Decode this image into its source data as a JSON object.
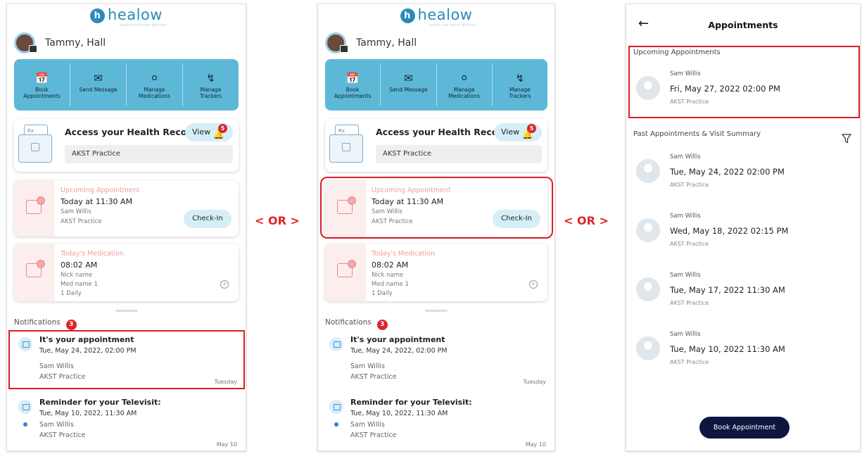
{
  "logo": {
    "text": "healow",
    "tagline": "Health and Online Wellness"
  },
  "separator_text": "< OR >",
  "dashboard": {
    "user_name": "Tammy, Hall",
    "quick_actions": [
      {
        "label": "Book\nAppointments",
        "icon": "calendar-search-icon"
      },
      {
        "label": "Send Message",
        "icon": "envelope-icon"
      },
      {
        "label": "Manage\nMedications",
        "icon": "pill-icon"
      },
      {
        "label": "Manage\nTrackers",
        "icon": "heartbeat-icon"
      }
    ],
    "health_records": {
      "title": "Access your Health Records",
      "view_label": "View",
      "notification_count": "5",
      "practice": "AKST Practice"
    },
    "upcoming": {
      "label": "Upcoming Appointment",
      "time": "Today at 11:30 AM",
      "provider": "Sam Willis",
      "practice": "AKST Practice",
      "checkin_label": "Check-In"
    },
    "medication": {
      "label": "Today's Medication",
      "time": "08:02 AM",
      "nickname": "Nick name",
      "name": "Med name 1",
      "frequency": "1 Daily"
    },
    "notifications_label": "Notifications",
    "notifications_count": "3",
    "notifications": [
      {
        "title": "It's your appointment",
        "date": "Tue, May 24, 2022, 02:00 PM",
        "provider": "Sam Willis",
        "practice": "AKST Practice",
        "day": "Tuesday"
      },
      {
        "title": "Reminder for your Televisit:",
        "date": "Tue, May 10, 2022, 11:30 AM",
        "provider": "Sam Willis",
        "practice": "AKST Practice",
        "day": "May 10"
      }
    ]
  },
  "appointments_screen": {
    "title": "Appointments",
    "upcoming_heading": "Upcoming Appointments",
    "upcoming": {
      "provider": "Sam Willis",
      "date": "Fri, May 27, 2022 02:00 PM",
      "practice": "AKST Practice"
    },
    "past_heading": "Past Appointments & Visit Summary",
    "past": [
      {
        "provider": "Sam Willis",
        "date": "Tue, May 24, 2022 02:00 PM",
        "practice": "AKST Practice"
      },
      {
        "provider": "Sam Willis",
        "date": "Wed, May 18, 2022 02:15 PM",
        "practice": "AKST Practice"
      },
      {
        "provider": "Sam Willis",
        "date": "Tue, May 17, 2022 11:30 AM",
        "practice": "AKST Practice"
      },
      {
        "provider": "Sam Willis",
        "date": "Tue, May 10, 2022 11:30 AM",
        "practice": "AKST Practice"
      }
    ],
    "book_label": "Book Appointment"
  },
  "colors": {
    "accent": "#5db8d8",
    "highlight": "#d81e27",
    "badge": "#d9262a",
    "button_dark": "#0e1640"
  }
}
